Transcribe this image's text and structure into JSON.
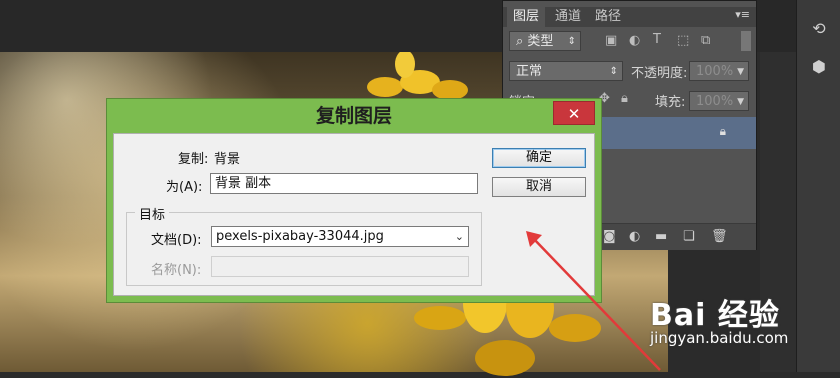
{
  "layers_panel": {
    "tabs": [
      "图层",
      "通道",
      "路径"
    ],
    "filter_kind": "类型",
    "blend_mode": "正常",
    "opacity_label": "不透明度:",
    "opacity_value": "100%",
    "lock_label": "锁定:",
    "fill_label": "填充:",
    "fill_value": "100%"
  },
  "dialog": {
    "title": "复制图层",
    "close_glyph": "✕",
    "copy_label": "复制:",
    "copy_value": "背景",
    "as_label": "为(A):",
    "as_value": "背景 副本",
    "ok_button": "确定",
    "cancel_button": "取消",
    "group_title": "目标",
    "document_label": "文档(D):",
    "document_value": "pexels-pixabay-33044.jpg",
    "name_label": "名称(N):",
    "name_value": ""
  },
  "watermark": {
    "logo": "Bai 经验",
    "url": "jingyan.baidu.com"
  },
  "colors": {
    "dialog_frame": "#7cbc4f",
    "close_button": "#c9363c",
    "selected_layer": "#5b6e8a",
    "annotation_arrow": "#e23a3a"
  }
}
